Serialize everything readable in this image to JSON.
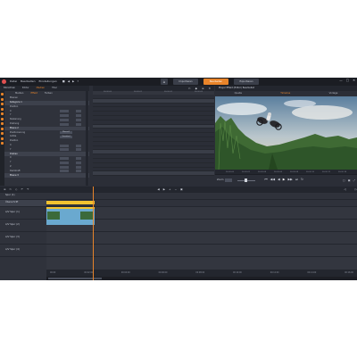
{
  "titlebar": {
    "menu": [
      "Datei",
      "Bearbeiten",
      "Einstellungen"
    ],
    "quick_actions": [
      "■",
      "◀",
      "▶",
      "?"
    ],
    "home_icon": "home-icon",
    "mode_tabs": [
      "Importieren",
      "Bearbeiten",
      "Exportieren"
    ],
    "active_mode": "Bearbeiten",
    "window_controls": [
      "—",
      "□",
      "✕"
    ]
  },
  "library_tabs": [
    "Bibliothek",
    "Editor",
    "Medien",
    "Titel"
  ],
  "editor_panel": {
    "subtabs": [
      "Medien",
      "Effekt",
      "Farben"
    ],
    "active_subtab": "Effekt",
    "rows": [
      {
        "label": "Ebenen",
        "type": "plain"
      },
      {
        "label": "Kategorie 1",
        "type": "section"
      },
      {
        "label": "Position",
        "type": "plain"
      },
      {
        "label": "X",
        "type": "value"
      },
      {
        "label": "Y",
        "type": "value"
      },
      {
        "label": "Skalierung",
        "type": "value"
      },
      {
        "label": "Drehung",
        "type": "value"
      },
      {
        "label": "Ebene 2",
        "type": "section"
      },
      {
        "label": "Positionierung",
        "type": "header",
        "btn": "Manuell"
      },
      {
        "label": "Größe",
        "type": "header",
        "btn": "Standard"
      },
      {
        "label": "Position",
        "type": "plain"
      },
      {
        "label": "X",
        "type": "value"
      },
      {
        "label": "Y",
        "type": "value"
      },
      {
        "label": "Drehen",
        "type": "section"
      },
      {
        "label": "X",
        "type": "value"
      },
      {
        "label": "Y",
        "type": "value"
      },
      {
        "label": "Z",
        "type": "value"
      },
      {
        "label": "Deckkraft",
        "type": "value"
      },
      {
        "label": "Ebene 3",
        "type": "section"
      }
    ]
  },
  "keyframes": {
    "toolbar_icons": [
      "✂",
      "◆",
      "≡",
      "✕"
    ],
    "ruler": [
      "00:00:00",
      "00:00:01",
      "00:00:02",
      "00:00:03"
    ]
  },
  "preview": {
    "title": "Player Effekt (Editor) Bearbeitet",
    "tabs": [
      "Quelle",
      "Timeline",
      "Vorlage"
    ],
    "active_tab": "Timeline",
    "ruler": [
      "00:00:00",
      "00:00:02",
      "00:00:04",
      "00:00:06",
      "00:00:08",
      "00:00:10",
      "00:00:12",
      "00:00:14"
    ],
    "zoom_label": "Zoom",
    "transport": [
      "⏮",
      "◀◀",
      "◀",
      "▶",
      "▶▶",
      "⏭",
      "↻"
    ],
    "right_icons": [
      "▢",
      "▣",
      "⤢"
    ]
  },
  "timeline": {
    "toolbar_left": [
      "≡",
      "✂",
      "◇",
      "↶",
      "↷"
    ],
    "toolbar_mid": [
      "◀",
      "▶",
      "+",
      "−",
      "▣"
    ],
    "toolbar_right": [
      "◁",
      "▷"
    ],
    "tracks": [
      {
        "name": "Spur (1)",
        "size": "sm"
      },
      {
        "name": "Überschrift",
        "size": "sm",
        "highlight": true
      },
      {
        "name": "A/V Spur (1)",
        "size": "lg"
      },
      {
        "name": "A/V Spur (2)",
        "size": "lg"
      },
      {
        "name": "A/V Spur (3)",
        "size": "lg"
      },
      {
        "name": "A/V Spur (4)",
        "size": "lg"
      }
    ],
    "ruler": [
      "00:00",
      "00:02:00",
      "00:04:00",
      "00:06:00",
      "00:08:00",
      "00:10:00",
      "00:12:00",
      "00:14:00",
      "00:16:00"
    ]
  },
  "colors": {
    "accent": "#e8842a",
    "clip_video": "#6aa9cf",
    "clip_title": "#f2c230"
  }
}
